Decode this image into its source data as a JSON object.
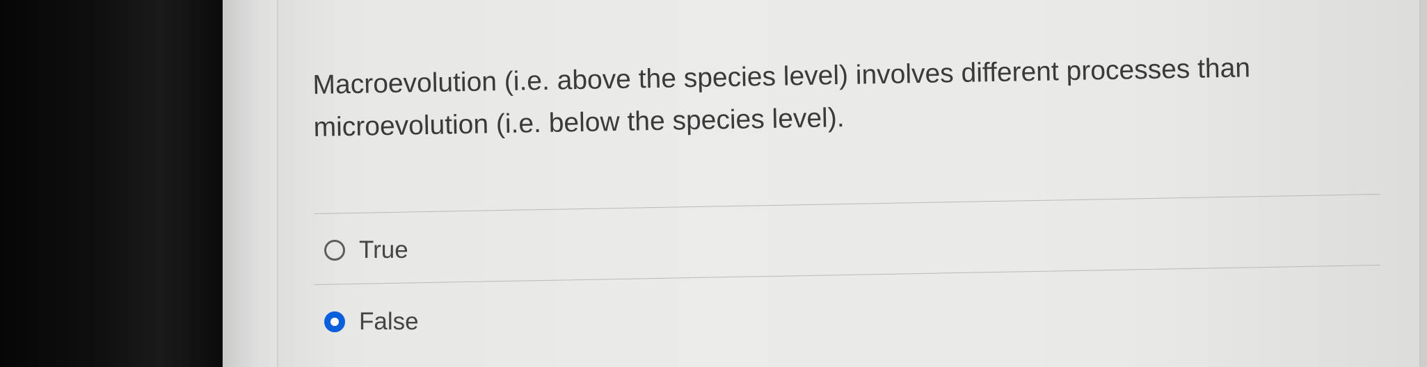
{
  "question": {
    "text": "Macroevolution (i.e. above the species level) involves different processes than microevolution (i.e. below the species level)."
  },
  "options": [
    {
      "label": "True",
      "selected": false
    },
    {
      "label": "False",
      "selected": true
    }
  ],
  "colors": {
    "selected_radio": "#0b5fdc",
    "text": "#3a3a3a",
    "background": "#e9e9e7"
  }
}
